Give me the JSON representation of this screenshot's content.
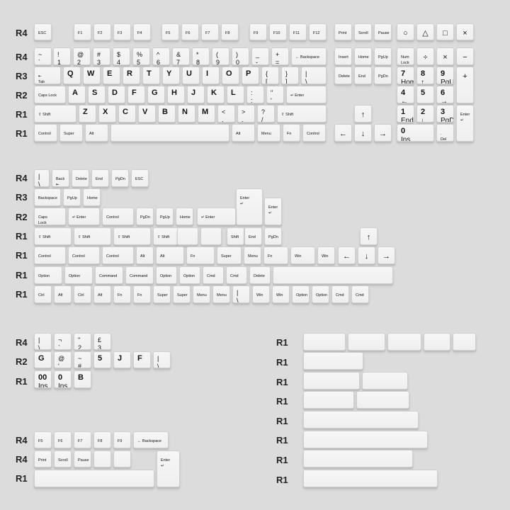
{
  "background": "#dcdcdc",
  "keycap_color": "#f6f6f6",
  "row_labels": [
    {
      "t": "R4"
    },
    {
      "t": "R4"
    },
    {
      "t": "R3"
    },
    {
      "t": "R2"
    },
    {
      "t": "R1"
    },
    {
      "t": "R1"
    },
    {
      "t": "R4"
    },
    {
      "t": "R3"
    },
    {
      "t": "R2"
    },
    {
      "t": "R1"
    },
    {
      "t": "R1"
    },
    {
      "t": "R1"
    },
    {
      "t": "R1"
    },
    {
      "t": "R4"
    },
    {
      "t": "R2"
    },
    {
      "t": "R1"
    },
    {
      "t": "R4"
    },
    {
      "t": "R4"
    },
    {
      "t": "R1"
    },
    {
      "t": "R1"
    },
    {
      "t": "R1"
    },
    {
      "t": "R1"
    },
    {
      "t": "R1"
    },
    {
      "t": "R1"
    },
    {
      "t": "R1"
    },
    {
      "t": "R1"
    },
    {
      "t": "R1"
    }
  ],
  "keys": [
    {
      "l1": "ESC",
      "c": "small"
    },
    {
      "l1": "F1",
      "c": "small"
    },
    {
      "l1": "F2",
      "c": "small"
    },
    {
      "l1": "F3",
      "c": "small"
    },
    {
      "l1": "F4",
      "c": "small"
    },
    {
      "l1": "F5",
      "c": "small"
    },
    {
      "l1": "F6",
      "c": "small"
    },
    {
      "l1": "F7",
      "c": "small"
    },
    {
      "l1": "F8",
      "c": "small"
    },
    {
      "l1": "F9",
      "c": "small"
    },
    {
      "l1": "F10",
      "c": "small"
    },
    {
      "l1": "F11",
      "c": "small"
    },
    {
      "l1": "F12",
      "c": "small"
    },
    {
      "l1": "Print",
      "c": "small"
    },
    {
      "l1": "Scroll",
      "c": "small"
    },
    {
      "l1": "Pause",
      "c": "small"
    },
    {
      "l1": "○",
      "c": "ctr"
    },
    {
      "l1": "△",
      "c": "ctr"
    },
    {
      "l1": "□",
      "c": "ctr"
    },
    {
      "l1": "×",
      "c": "ctr"
    },
    {
      "l1": "~",
      "l2": "`"
    },
    {
      "l1": "!",
      "l2": "1"
    },
    {
      "l1": "@",
      "l2": "2"
    },
    {
      "l1": "#",
      "l2": "3"
    },
    {
      "l1": "$",
      "l2": "4"
    },
    {
      "l1": "%",
      "l2": "5"
    },
    {
      "l1": "^",
      "l2": "6"
    },
    {
      "l1": "&",
      "l2": "7"
    },
    {
      "l1": "*",
      "l2": "8"
    },
    {
      "l1": "(",
      "l2": "9"
    },
    {
      "l1": ")",
      "l2": "0"
    },
    {
      "l1": "_",
      "l2": "-"
    },
    {
      "l1": "+",
      "l2": "="
    },
    {
      "l1": "← Backspace",
      "c": "small"
    },
    {
      "l1": "Insert",
      "c": "small"
    },
    {
      "l1": "Home",
      "c": "small"
    },
    {
      "l1": "PgUp",
      "c": "small"
    },
    {
      "l1": "Num",
      "l2": "Lock",
      "c": "small"
    },
    {
      "l1": "÷",
      "c": "ctr"
    },
    {
      "l1": "×",
      "c": "ctr"
    },
    {
      "l1": "−",
      "c": "ctr"
    },
    {
      "l1": "⇤",
      "l2": "Tab",
      "c": "small"
    },
    {
      "l1": "Q",
      "c": "big"
    },
    {
      "l1": "W",
      "c": "big"
    },
    {
      "l1": "E",
      "c": "big"
    },
    {
      "l1": "R",
      "c": "big"
    },
    {
      "l1": "T",
      "c": "big"
    },
    {
      "l1": "Y",
      "c": "big"
    },
    {
      "l1": "U",
      "c": "big"
    },
    {
      "l1": "I",
      "c": "big"
    },
    {
      "l1": "O",
      "c": "big"
    },
    {
      "l1": "P",
      "c": "big"
    },
    {
      "l1": "{",
      "l2": "["
    },
    {
      "l1": "}",
      "l2": "]"
    },
    {
      "l1": "|",
      "l2": "\\"
    },
    {
      "l1": "Delete",
      "c": "small"
    },
    {
      "l1": "End",
      "c": "small"
    },
    {
      "l1": "PgDn",
      "c": "small"
    },
    {
      "l1": "7",
      "l2": "Home",
      "c": "big"
    },
    {
      "l1": "8",
      "l2": "↑",
      "c": "big"
    },
    {
      "l1": "9",
      "l2": "PgUp",
      "c": "big"
    },
    {
      "l1": "+",
      "c": "ctr"
    },
    {
      "l1": "Caps Lock",
      "c": "small"
    },
    {
      "l1": "A",
      "c": "big"
    },
    {
      "l1": "S",
      "c": "big"
    },
    {
      "l1": "D",
      "c": "big"
    },
    {
      "l1": "F",
      "c": "big"
    },
    {
      "l1": "G",
      "c": "big"
    },
    {
      "l1": "H",
      "c": "big"
    },
    {
      "l1": "J",
      "c": "big"
    },
    {
      "l1": "K",
      "c": "big"
    },
    {
      "l1": "L",
      "c": "big"
    },
    {
      "l1": ":",
      "l2": ";"
    },
    {
      "l1": "\"",
      "l2": "'"
    },
    {
      "l1": "↵ Enter",
      "c": "small"
    },
    {
      "l1": "4",
      "l2": "←",
      "c": "big"
    },
    {
      "l1": "5",
      "c": "big"
    },
    {
      "l1": "6",
      "l2": "→",
      "c": "big"
    },
    {
      "l1": "⇧ Shift",
      "c": "small"
    },
    {
      "l1": "Z",
      "c": "big"
    },
    {
      "l1": "X",
      "c": "big"
    },
    {
      "l1": "C",
      "c": "big"
    },
    {
      "l1": "V",
      "c": "big"
    },
    {
      "l1": "B",
      "c": "big"
    },
    {
      "l1": "N",
      "c": "big"
    },
    {
      "l1": "M",
      "c": "big"
    },
    {
      "l1": "<",
      "l2": ","
    },
    {
      "l1": ">",
      "l2": "."
    },
    {
      "l1": "?",
      "l2": "/"
    },
    {
      "l1": "⇧ Shift",
      "c": "small"
    },
    {
      "l1": "↑",
      "c": "ctr"
    },
    {
      "l1": "1",
      "l2": "End",
      "c": "big"
    },
    {
      "l1": "2",
      "l2": "↓",
      "c": "big"
    },
    {
      "l1": "3",
      "l2": "PgDn",
      "c": "big"
    },
    {
      "l1": "Enter",
      "l2": "↵",
      "c": "small"
    },
    {
      "l1": "Control",
      "c": "small"
    },
    {
      "l1": "Super",
      "c": "small"
    },
    {
      "l1": "Alt",
      "c": "small"
    },
    {
      "l1": ""
    },
    {
      "l1": "Alt",
      "c": "small"
    },
    {
      "l1": "Menu",
      "c": "small"
    },
    {
      "l1": "Fn",
      "c": "small"
    },
    {
      "l1": "Control",
      "c": "small"
    },
    {
      "l1": "←",
      "c": "ctr"
    },
    {
      "l1": "↓",
      "c": "ctr"
    },
    {
      "l1": "→",
      "c": "ctr"
    },
    {
      "l1": "0",
      "l2": "Ins",
      "c": "big"
    },
    {
      "l1": ".",
      "l2": "Del",
      "c": "small"
    },
    {
      "l1": "|",
      "l2": "\\"
    },
    {
      "l1": "Back",
      "l2": "⇤",
      "c": "small"
    },
    {
      "l1": "Delete",
      "c": "small"
    },
    {
      "l1": "End",
      "c": "small"
    },
    {
      "l1": "PgDn",
      "c": "small"
    },
    {
      "l1": "ESC",
      "c": "small"
    },
    {
      "l1": "Backspace",
      "c": "small"
    },
    {
      "l1": "PgUp",
      "c": "small"
    },
    {
      "l1": "Home",
      "c": "small"
    },
    {
      "l1": "Enter",
      "l2": "↵",
      "c": "small"
    },
    {
      "l1": "Enter",
      "l2": "↵",
      "c": "small"
    },
    {
      "l1": "Caps",
      "l2": "Lock",
      "c": "small"
    },
    {
      "l1": "↵ Enter",
      "c": "small"
    },
    {
      "l1": "Control",
      "c": "small"
    },
    {
      "l1": "PgDn",
      "c": "small"
    },
    {
      "l1": "PgUp",
      "c": "small"
    },
    {
      "l1": "Home",
      "c": "small"
    },
    {
      "l1": "↵ Enter",
      "c": "small"
    },
    {
      "l1": "⇧ Shift",
      "c": "small"
    },
    {
      "l1": "⇧ Shift",
      "c": "small"
    },
    {
      "l1": "⇧ Shift",
      "c": "small"
    },
    {
      "l1": "⇧ Shift",
      "c": "small"
    },
    {
      "l1": ""
    },
    {
      "l1": ""
    },
    {
      "l1": "Shift",
      "c": "small"
    },
    {
      "l1": "End",
      "c": "small"
    },
    {
      "l1": "PgDn",
      "c": "small"
    },
    {
      "l1": "↑",
      "c": "ctr"
    },
    {
      "l1": "Control",
      "c": "small"
    },
    {
      "l1": "Control",
      "c": "small"
    },
    {
      "l1": "Control",
      "c": "small"
    },
    {
      "l1": "Alt",
      "c": "small"
    },
    {
      "l1": "Alt",
      "c": "small"
    },
    {
      "l1": "Fn",
      "c": "small"
    },
    {
      "l1": "Super",
      "c": "small"
    },
    {
      "l1": "Menu",
      "c": "small"
    },
    {
      "l1": "Fn",
      "c": "small"
    },
    {
      "l1": "Win",
      "c": "small"
    },
    {
      "l1": "Win",
      "c": "small"
    },
    {
      "l1": "←",
      "c": "ctr"
    },
    {
      "l1": "↓",
      "c": "ctr"
    },
    {
      "l1": "→",
      "c": "ctr"
    },
    {
      "l1": "Option",
      "c": "small"
    },
    {
      "l1": "Option",
      "c": "small"
    },
    {
      "l1": "Command",
      "c": "small"
    },
    {
      "l1": "Command",
      "c": "small"
    },
    {
      "l1": "Option",
      "c": "small"
    },
    {
      "l1": "Option",
      "c": "small"
    },
    {
      "l1": "Cmd",
      "c": "small"
    },
    {
      "l1": "Cmd",
      "c": "small"
    },
    {
      "l1": "Delete",
      "c": "small"
    },
    {
      "l1": ""
    },
    {
      "l1": "Ctrl",
      "c": "small"
    },
    {
      "l1": "Alt",
      "c": "small"
    },
    {
      "l1": "Ctrl",
      "c": "small"
    },
    {
      "l1": "Alt",
      "c": "small"
    },
    {
      "l1": "Fn",
      "c": "small"
    },
    {
      "l1": "Fn",
      "c": "small"
    },
    {
      "l1": "Super",
      "c": "small"
    },
    {
      "l1": "Super",
      "c": "small"
    },
    {
      "l1": "Menu",
      "c": "small"
    },
    {
      "l1": "Menu",
      "c": "small"
    },
    {
      "l1": "|",
      "l2": "\\"
    },
    {
      "l1": "Win",
      "c": "small"
    },
    {
      "l1": "Win",
      "c": "small"
    },
    {
      "l1": "Option",
      "c": "small"
    },
    {
      "l1": "Option",
      "c": "small"
    },
    {
      "l1": "Cmd",
      "c": "small"
    },
    {
      "l1": "Cmd",
      "c": "small"
    },
    {
      "l1": "|",
      "l2": "\\"
    },
    {
      "l1": "¬",
      "l2": "`"
    },
    {
      "l1": "\"",
      "l2": "2"
    },
    {
      "l1": "£",
      "l2": "3"
    },
    {
      "l1": "G",
      "c": "big"
    },
    {
      "l1": "@",
      "l2": "'"
    },
    {
      "l1": "~",
      "l2": "#"
    },
    {
      "l1": "5",
      "c": "big"
    },
    {
      "l1": "J",
      "c": "big"
    },
    {
      "l1": "F",
      "c": "big"
    },
    {
      "l1": "|",
      "l2": "\\"
    },
    {
      "l1": "00",
      "l2": "Ins",
      "c": "big"
    },
    {
      "l1": "0",
      "l2": "Ins",
      "c": "big"
    },
    {
      "l1": "B",
      "c": "big"
    },
    {
      "l1": "F5",
      "c": "small"
    },
    {
      "l1": "F6",
      "c": "small"
    },
    {
      "l1": "F7",
      "c": "small"
    },
    {
      "l1": "F8",
      "c": "small"
    },
    {
      "l1": "F9",
      "c": "small"
    },
    {
      "l1": "← Backspace",
      "c": "small"
    },
    {
      "l1": "Print",
      "c": "small"
    },
    {
      "l1": "Scroll",
      "c": "small"
    },
    {
      "l1": "Pause",
      "c": "small"
    },
    {
      "l1": ""
    },
    {
      "l1": ""
    },
    {
      "l1": "Enter",
      "l2": "↵",
      "c": "small"
    },
    {
      "l1": ""
    },
    {
      "l1": ""
    },
    {
      "l1": ""
    },
    {
      "l1": ""
    },
    {
      "l1": ""
    },
    {
      "l1": ""
    },
    {
      "l1": ""
    },
    {
      "l1": ""
    },
    {
      "l1": ""
    },
    {
      "l1": ""
    },
    {
      "l1": ""
    },
    {
      "l1": ""
    },
    {
      "l1": ""
    },
    {
      "l1": ""
    },
    {
      "l1": ""
    },
    {
      "l1": ""
    }
  ]
}
